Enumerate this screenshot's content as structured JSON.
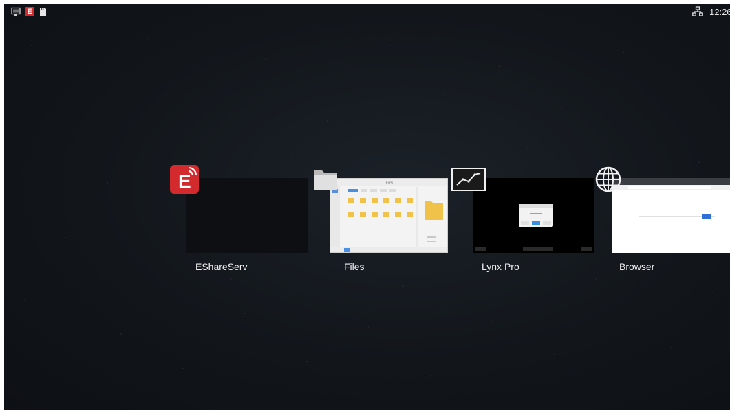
{
  "status_bar": {
    "left_icons": [
      "screen-mirror-icon",
      "eshare-icon",
      "sd-card-icon"
    ],
    "eshare_letter": "E",
    "network_icon": "ethernet-icon",
    "time": "12:26"
  },
  "recents": [
    {
      "id": "eshare",
      "label": "EShareServ",
      "icon": "eshare-app-icon",
      "icon_letter": "E",
      "color": "#d32a2d"
    },
    {
      "id": "files",
      "label": "Files",
      "icon": "folder-icon",
      "thumbnail": {
        "title": "Files"
      }
    },
    {
      "id": "lynx",
      "label": "Lynx Pro",
      "icon": "line-chart-icon"
    },
    {
      "id": "browser",
      "label": "Browser",
      "icon": "globe-icon"
    }
  ]
}
